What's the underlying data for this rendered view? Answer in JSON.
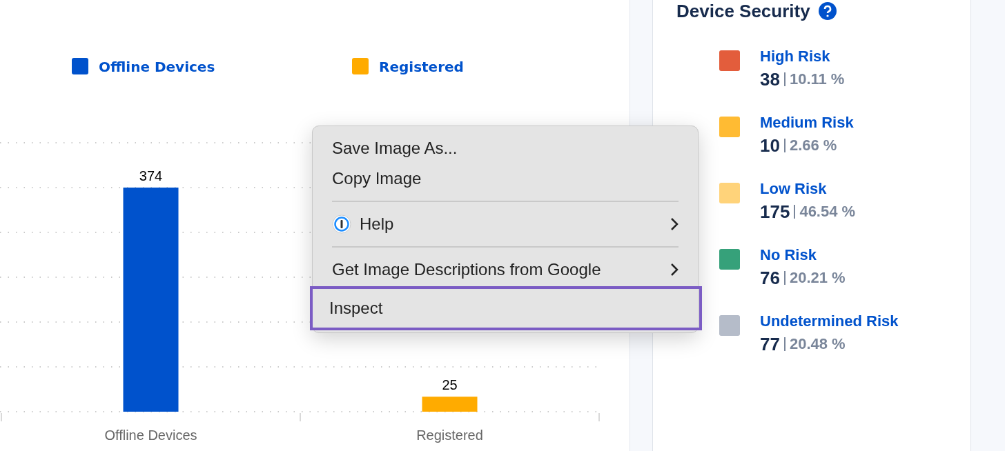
{
  "chart": {
    "chart_data": {
      "type": "bar",
      "categories": [
        "Offline Devices",
        "Registered"
      ],
      "series": [
        {
          "name": "Offline Devices",
          "color": "#0052cc",
          "values": [
            374,
            null
          ]
        },
        {
          "name": "Registered",
          "color": "#ffab00",
          "values": [
            null,
            25
          ]
        }
      ],
      "data_labels": true
    }
  },
  "context_menu": {
    "groups": [
      [
        {
          "kind": "plain",
          "label": "Save Image As...",
          "submenu": false,
          "selected": false
        },
        {
          "kind": "plain",
          "label": "Copy Image",
          "submenu": false,
          "selected": false
        }
      ],
      [
        {
          "kind": "with-icon",
          "label": "Help",
          "submenu": true,
          "selected": false
        }
      ],
      [
        {
          "kind": "plain",
          "label": "Get Image Descriptions from Google",
          "submenu": true,
          "selected": false
        }
      ],
      [
        {
          "kind": "plain",
          "label": "Inspect",
          "submenu": false,
          "selected": true
        }
      ]
    ]
  },
  "device_security": {
    "title": "Device Security",
    "items": [
      {
        "label": "High Risk",
        "count": "38",
        "percent": "10.11 %",
        "color": "#e35d3c"
      },
      {
        "label": "Medium Risk",
        "count": "10",
        "percent": "2.66 %",
        "color": "#ffbb33"
      },
      {
        "label": "Low Risk",
        "count": "175",
        "percent": "46.54 %",
        "color": "#ffd37a"
      },
      {
        "label": "No Risk",
        "count": "76",
        "percent": "20.21 %",
        "color": "#36a17a"
      },
      {
        "label": "Undetermined Risk",
        "count": "77",
        "percent": "20.48 %",
        "color": "#b5bcc9"
      }
    ]
  }
}
